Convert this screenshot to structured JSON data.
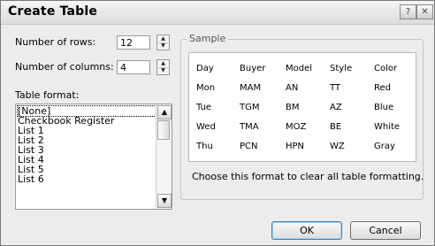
{
  "dialog": {
    "title": "Create Table",
    "help_glyph": "?",
    "close_glyph": "✕"
  },
  "rows": {
    "label": "Number of rows:",
    "value": "12"
  },
  "columns": {
    "label": "Number of columns:",
    "value": "4"
  },
  "table_format": {
    "label": "Table format:",
    "items": [
      "[None]",
      "Checkbook Register",
      "List 1",
      "List 2",
      "List 3",
      "List 4",
      "List 5",
      "List 6"
    ],
    "selected": "[None]"
  },
  "sample": {
    "title": "Sample",
    "rows": [
      [
        "Day",
        "Buyer",
        "Model",
        "Style",
        "Color"
      ],
      [
        "Mon",
        "MAM",
        "AN",
        "TT",
        "Red"
      ],
      [
        "Tue",
        "TGM",
        "BM",
        "AZ",
        "Blue"
      ],
      [
        "Wed",
        "TMA",
        "MOZ",
        "BE",
        "White"
      ],
      [
        "Thu",
        "PCN",
        "HPN",
        "WZ",
        "Gray"
      ]
    ],
    "description": "Choose this format to clear all table formatting."
  },
  "buttons": {
    "ok": "OK",
    "cancel": "Cancel"
  }
}
